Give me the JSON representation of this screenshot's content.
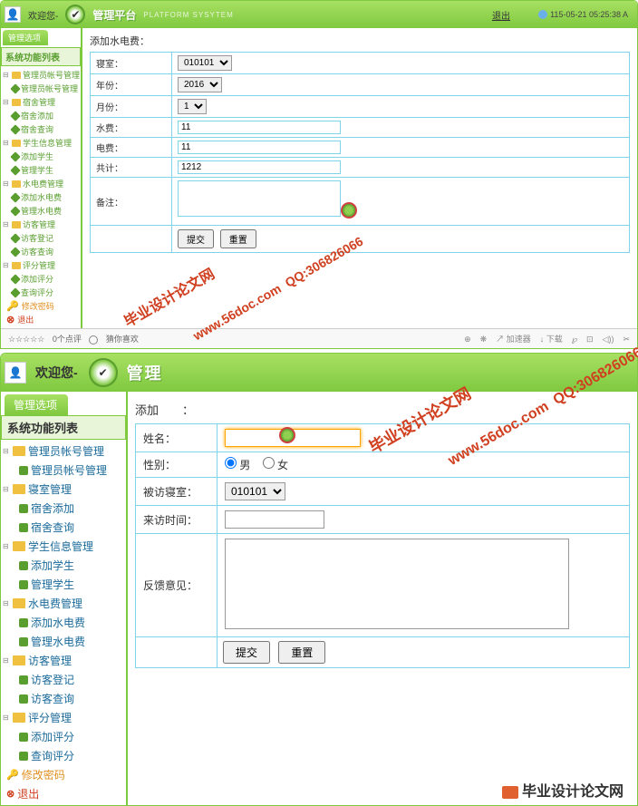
{
  "top": {
    "welcome": "欢迎您-",
    "platform_title": "管理平台",
    "platform_sub": "PLATFORM SYSYTEM",
    "logout": "退出",
    "timestamp": "115-05-21 05:25:38 A",
    "mgmt_tab": "管理选项",
    "sidebar_title": "系统功能列表",
    "tree": [
      {
        "label": "管理员帐号管理",
        "type": "folder",
        "toggle": "⊟",
        "children": [
          {
            "label": "管理员帐号管理",
            "type": "leaf"
          }
        ]
      },
      {
        "label": "宿舍管理",
        "type": "folder",
        "toggle": "⊟",
        "children": [
          {
            "label": "宿舍添加",
            "type": "leaf"
          },
          {
            "label": "宿舍查询",
            "type": "leaf"
          }
        ]
      },
      {
        "label": "学生信息管理",
        "type": "folder",
        "toggle": "⊟",
        "children": [
          {
            "label": "添加学生",
            "type": "leaf"
          },
          {
            "label": "管理学生",
            "type": "leaf"
          }
        ]
      },
      {
        "label": "水电费管理",
        "type": "folder",
        "toggle": "⊟",
        "children": [
          {
            "label": "添加水电费",
            "type": "leaf"
          },
          {
            "label": "管理水电费",
            "type": "leaf"
          }
        ]
      },
      {
        "label": "访客管理",
        "type": "folder",
        "toggle": "⊟",
        "children": [
          {
            "label": "访客登记",
            "type": "leaf"
          },
          {
            "label": "访客查询",
            "type": "leaf"
          }
        ]
      },
      {
        "label": "评分管理",
        "type": "folder",
        "toggle": "⊟",
        "children": [
          {
            "label": "添加评分",
            "type": "leaf"
          },
          {
            "label": "查询评分",
            "type": "leaf"
          }
        ]
      },
      {
        "label": "修改密码",
        "type": "key"
      },
      {
        "label": "退出",
        "type": "exit"
      }
    ],
    "form": {
      "title": "添加水电费：",
      "dorm_label": "寝室：",
      "dorm_value": "010101",
      "year_label": "年份：",
      "year_value": "2016",
      "month_label": "月份：",
      "month_value": "1",
      "water_label": "水费：",
      "water_value": "11",
      "elec_label": "电费：",
      "elec_value": "11",
      "total_label": "共计：",
      "total_value": "1212",
      "remark_label": "备注：",
      "remark_value": "",
      "submit": "提交",
      "reset": "重置"
    },
    "footer": {
      "stars": "☆☆☆☆☆",
      "rating": "0个点评",
      "like": "猜你喜欢",
      "tools": [
        "⊕",
        "❋",
        "↗ 加速器",
        "↓ 下载",
        "℘",
        "⊡",
        "◁))",
        "✂"
      ]
    }
  },
  "bottom": {
    "welcome": "欢迎您-",
    "platform_title": "管理",
    "mgmt_tab": "管理选项",
    "sidebar_title": "系统功能列表",
    "tree": [
      {
        "label": "管理员帐号管理",
        "type": "folder",
        "toggle": "⊟",
        "children": [
          {
            "label": "管理员帐号管理",
            "type": "leaf"
          }
        ]
      },
      {
        "label": "寝室管理",
        "type": "folder",
        "toggle": "⊟",
        "children": [
          {
            "label": "宿舍添加",
            "type": "leaf"
          },
          {
            "label": "宿舍查询",
            "type": "leaf"
          }
        ]
      },
      {
        "label": "学生信息管理",
        "type": "folder",
        "toggle": "⊟",
        "children": [
          {
            "label": "添加学生",
            "type": "leaf"
          },
          {
            "label": "管理学生",
            "type": "leaf"
          }
        ]
      },
      {
        "label": "水电费管理",
        "type": "folder",
        "toggle": "⊟",
        "children": [
          {
            "label": "添加水电费",
            "type": "leaf"
          },
          {
            "label": "管理水电费",
            "type": "leaf"
          }
        ]
      },
      {
        "label": "访客管理",
        "type": "folder",
        "toggle": "⊟",
        "children": [
          {
            "label": "访客登记",
            "type": "leaf"
          },
          {
            "label": "访客查询",
            "type": "leaf"
          }
        ]
      },
      {
        "label": "评分管理",
        "type": "folder",
        "toggle": "⊟",
        "children": [
          {
            "label": "添加评分",
            "type": "leaf"
          },
          {
            "label": "查询评分",
            "type": "leaf"
          }
        ]
      },
      {
        "label": "修改密码",
        "type": "key"
      },
      {
        "label": "退出",
        "type": "exit"
      }
    ],
    "form": {
      "title": "添加",
      "title_suffix": "：",
      "name_label": "姓名：",
      "name_value": "",
      "gender_label": "性别：",
      "gender_male": "男",
      "gender_female": "女",
      "dorm_label": "被访寝室：",
      "dorm_value": "010101",
      "time_label": "来访时间：",
      "time_value": "",
      "feedback_label": "反馈意见：",
      "feedback_value": "",
      "submit": "提交",
      "reset": "重置"
    }
  },
  "watermarks": {
    "site": "毕业设计论文网",
    "url": "www.56doc.com",
    "qq": "QQ:306826066",
    "footer": "毕业设计论文网"
  }
}
